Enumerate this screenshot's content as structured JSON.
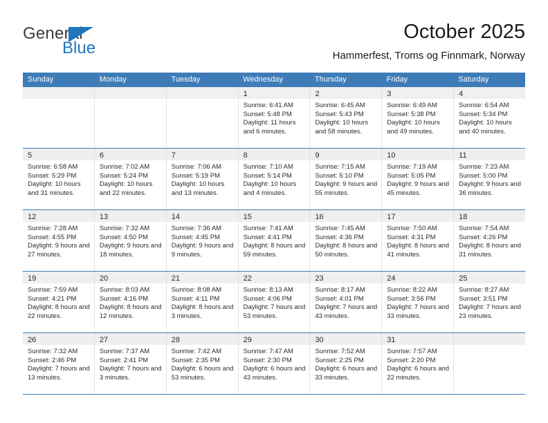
{
  "logo": {
    "word_top": "General",
    "word_bottom": "Blue",
    "triangle_color": "#1f76bc"
  },
  "header": {
    "title": "October 2025",
    "subtitle": "Hammerfest, Troms og Finnmark, Norway"
  },
  "theme": {
    "header_blue": "#3e7cb8",
    "band_gray": "#efefef",
    "text": "#2b2b2b"
  },
  "calendar": {
    "weekday_headers": [
      "Sunday",
      "Monday",
      "Tuesday",
      "Wednesday",
      "Thursday",
      "Friday",
      "Saturday"
    ],
    "labels": {
      "sunrise": "Sunrise:",
      "sunset": "Sunset:",
      "daylight": "Daylight:"
    },
    "weeks": [
      [
        {
          "day": "",
          "sunrise": "",
          "sunset": "",
          "daylight": ""
        },
        {
          "day": "",
          "sunrise": "",
          "sunset": "",
          "daylight": ""
        },
        {
          "day": "",
          "sunrise": "",
          "sunset": "",
          "daylight": ""
        },
        {
          "day": "1",
          "sunrise": "Sunrise: 6:41 AM",
          "sunset": "Sunset: 5:48 PM",
          "daylight": "Daylight: 11 hours and 6 minutes."
        },
        {
          "day": "2",
          "sunrise": "Sunrise: 6:45 AM",
          "sunset": "Sunset: 5:43 PM",
          "daylight": "Daylight: 10 hours and 58 minutes."
        },
        {
          "day": "3",
          "sunrise": "Sunrise: 6:49 AM",
          "sunset": "Sunset: 5:38 PM",
          "daylight": "Daylight: 10 hours and 49 minutes."
        },
        {
          "day": "4",
          "sunrise": "Sunrise: 6:54 AM",
          "sunset": "Sunset: 5:34 PM",
          "daylight": "Daylight: 10 hours and 40 minutes."
        }
      ],
      [
        {
          "day": "5",
          "sunrise": "Sunrise: 6:58 AM",
          "sunset": "Sunset: 5:29 PM",
          "daylight": "Daylight: 10 hours and 31 minutes."
        },
        {
          "day": "6",
          "sunrise": "Sunrise: 7:02 AM",
          "sunset": "Sunset: 5:24 PM",
          "daylight": "Daylight: 10 hours and 22 minutes."
        },
        {
          "day": "7",
          "sunrise": "Sunrise: 7:06 AM",
          "sunset": "Sunset: 5:19 PM",
          "daylight": "Daylight: 10 hours and 13 minutes."
        },
        {
          "day": "8",
          "sunrise": "Sunrise: 7:10 AM",
          "sunset": "Sunset: 5:14 PM",
          "daylight": "Daylight: 10 hours and 4 minutes."
        },
        {
          "day": "9",
          "sunrise": "Sunrise: 7:15 AM",
          "sunset": "Sunset: 5:10 PM",
          "daylight": "Daylight: 9 hours and 55 minutes."
        },
        {
          "day": "10",
          "sunrise": "Sunrise: 7:19 AM",
          "sunset": "Sunset: 5:05 PM",
          "daylight": "Daylight: 9 hours and 45 minutes."
        },
        {
          "day": "11",
          "sunrise": "Sunrise: 7:23 AM",
          "sunset": "Sunset: 5:00 PM",
          "daylight": "Daylight: 9 hours and 36 minutes."
        }
      ],
      [
        {
          "day": "12",
          "sunrise": "Sunrise: 7:28 AM",
          "sunset": "Sunset: 4:55 PM",
          "daylight": "Daylight: 9 hours and 27 minutes."
        },
        {
          "day": "13",
          "sunrise": "Sunrise: 7:32 AM",
          "sunset": "Sunset: 4:50 PM",
          "daylight": "Daylight: 9 hours and 18 minutes."
        },
        {
          "day": "14",
          "sunrise": "Sunrise: 7:36 AM",
          "sunset": "Sunset: 4:45 PM",
          "daylight": "Daylight: 9 hours and 9 minutes."
        },
        {
          "day": "15",
          "sunrise": "Sunrise: 7:41 AM",
          "sunset": "Sunset: 4:41 PM",
          "daylight": "Daylight: 8 hours and 59 minutes."
        },
        {
          "day": "16",
          "sunrise": "Sunrise: 7:45 AM",
          "sunset": "Sunset: 4:36 PM",
          "daylight": "Daylight: 8 hours and 50 minutes."
        },
        {
          "day": "17",
          "sunrise": "Sunrise: 7:50 AM",
          "sunset": "Sunset: 4:31 PM",
          "daylight": "Daylight: 8 hours and 41 minutes."
        },
        {
          "day": "18",
          "sunrise": "Sunrise: 7:54 AM",
          "sunset": "Sunset: 4:26 PM",
          "daylight": "Daylight: 8 hours and 31 minutes."
        }
      ],
      [
        {
          "day": "19",
          "sunrise": "Sunrise: 7:59 AM",
          "sunset": "Sunset: 4:21 PM",
          "daylight": "Daylight: 8 hours and 22 minutes."
        },
        {
          "day": "20",
          "sunrise": "Sunrise: 8:03 AM",
          "sunset": "Sunset: 4:16 PM",
          "daylight": "Daylight: 8 hours and 12 minutes."
        },
        {
          "day": "21",
          "sunrise": "Sunrise: 8:08 AM",
          "sunset": "Sunset: 4:11 PM",
          "daylight": "Daylight: 8 hours and 3 minutes."
        },
        {
          "day": "22",
          "sunrise": "Sunrise: 8:13 AM",
          "sunset": "Sunset: 4:06 PM",
          "daylight": "Daylight: 7 hours and 53 minutes."
        },
        {
          "day": "23",
          "sunrise": "Sunrise: 8:17 AM",
          "sunset": "Sunset: 4:01 PM",
          "daylight": "Daylight: 7 hours and 43 minutes."
        },
        {
          "day": "24",
          "sunrise": "Sunrise: 8:22 AM",
          "sunset": "Sunset: 3:56 PM",
          "daylight": "Daylight: 7 hours and 33 minutes."
        },
        {
          "day": "25",
          "sunrise": "Sunrise: 8:27 AM",
          "sunset": "Sunset: 3:51 PM",
          "daylight": "Daylight: 7 hours and 23 minutes."
        }
      ],
      [
        {
          "day": "26",
          "sunrise": "Sunrise: 7:32 AM",
          "sunset": "Sunset: 2:46 PM",
          "daylight": "Daylight: 7 hours and 13 minutes."
        },
        {
          "day": "27",
          "sunrise": "Sunrise: 7:37 AM",
          "sunset": "Sunset: 2:41 PM",
          "daylight": "Daylight: 7 hours and 3 minutes."
        },
        {
          "day": "28",
          "sunrise": "Sunrise: 7:42 AM",
          "sunset": "Sunset: 2:35 PM",
          "daylight": "Daylight: 6 hours and 53 minutes."
        },
        {
          "day": "29",
          "sunrise": "Sunrise: 7:47 AM",
          "sunset": "Sunset: 2:30 PM",
          "daylight": "Daylight: 6 hours and 43 minutes."
        },
        {
          "day": "30",
          "sunrise": "Sunrise: 7:52 AM",
          "sunset": "Sunset: 2:25 PM",
          "daylight": "Daylight: 6 hours and 33 minutes."
        },
        {
          "day": "31",
          "sunrise": "Sunrise: 7:57 AM",
          "sunset": "Sunset: 2:20 PM",
          "daylight": "Daylight: 6 hours and 22 minutes."
        },
        {
          "day": "",
          "sunrise": "",
          "sunset": "",
          "daylight": ""
        }
      ]
    ]
  }
}
